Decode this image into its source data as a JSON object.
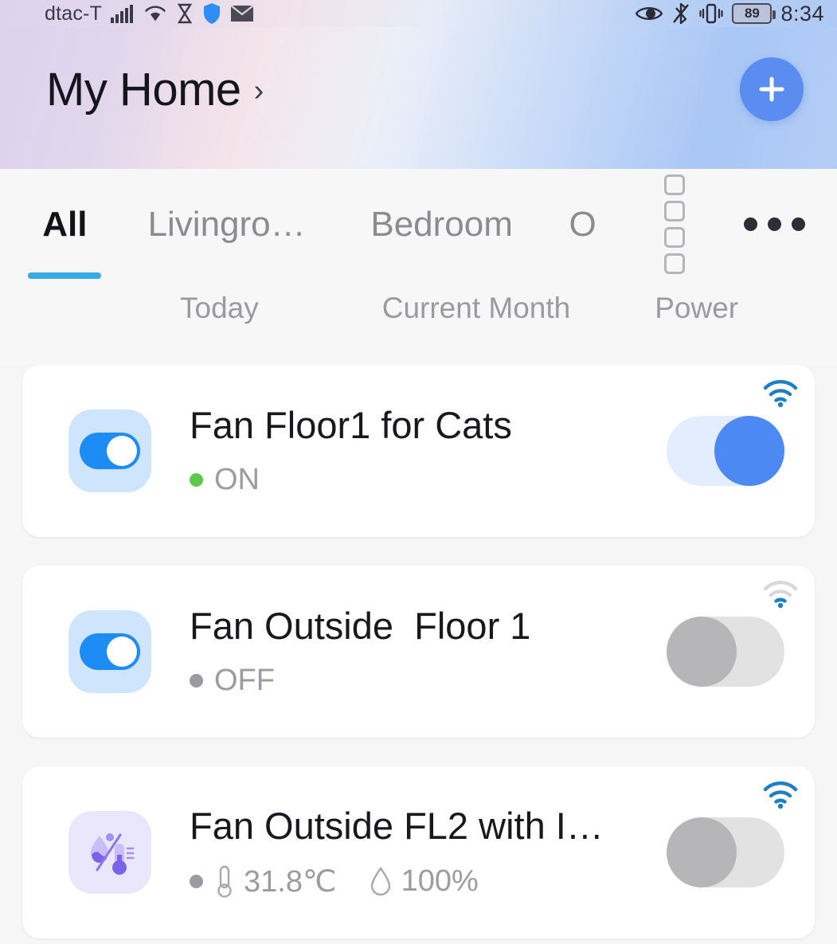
{
  "statusbar": {
    "carrier": "dtac-T",
    "time": "8:34",
    "battery": "89",
    "icons": [
      "signal-icon",
      "wifi-icon",
      "hourglass-icon",
      "shield-icon",
      "mail-icon",
      "eye-icon",
      "bluetooth-off-icon",
      "vibrate-icon",
      "battery-icon"
    ]
  },
  "header": {
    "title": "My Home",
    "chevron": "›",
    "add_label": "+"
  },
  "tabs": [
    {
      "label": "All",
      "active": true
    },
    {
      "label": "Livingro…",
      "active": false
    },
    {
      "label": "Bedroom",
      "active": false
    },
    {
      "label": "O",
      "active": false
    }
  ],
  "tab_actions": {
    "grid": "grid-view-icon",
    "more": "more-options-icon"
  },
  "subheader": {
    "today": "Today",
    "current_month": "Current Month",
    "power": "Power"
  },
  "devices": [
    {
      "name": "Fan Floor1 for Cats",
      "status": "ON",
      "status_color": "#5cc94b",
      "toggle": "on",
      "icon": "switch-icon",
      "wifi": "strong"
    },
    {
      "name": "Fan Outside  Floor 1",
      "status": "OFF",
      "status_color": "#9b9ba2",
      "toggle": "off",
      "icon": "switch-icon",
      "wifi": "weak"
    },
    {
      "name": "Fan Outside FL2 with I…",
      "temperature": "31.8℃",
      "humidity": "100%",
      "status_color": "#9b9ba2",
      "toggle": "off",
      "icon": "temp-humidity-sensor-icon",
      "wifi": "strong"
    }
  ],
  "colors": {
    "accent_blue": "#4c89f2",
    "tab_underline": "#39a9e8",
    "on_green": "#5cc94b",
    "off_gray": "#b6b6b8"
  }
}
